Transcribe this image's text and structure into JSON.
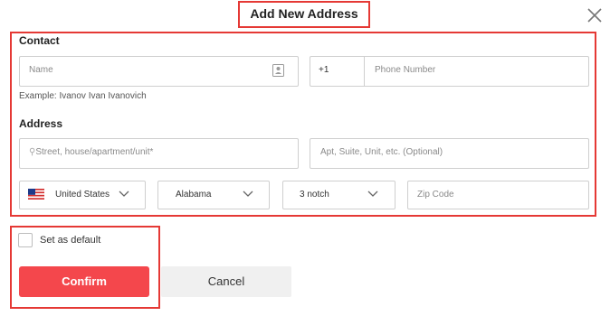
{
  "dialog": {
    "title": "Add New Address"
  },
  "contact": {
    "section_title": "Contact",
    "name_placeholder": "Name",
    "phone_code": "+1",
    "phone_placeholder": "Phone Number",
    "example": "Example: Ivanov Ivan Ivanovich"
  },
  "address": {
    "section_title": "Address",
    "street_placeholder": "Street, house/apartment/unit*",
    "apt_placeholder": "Apt, Suite, Unit, etc. (Optional)",
    "country": "United States",
    "state": "Alabama",
    "city": "3 notch",
    "zip_placeholder": "Zip Code"
  },
  "default_checkbox": {
    "label": "Set as default",
    "checked": false
  },
  "buttons": {
    "confirm": "Confirm",
    "cancel": "Cancel"
  },
  "colors": {
    "accent": "#f4474c",
    "highlight_outline": "#e53935"
  }
}
